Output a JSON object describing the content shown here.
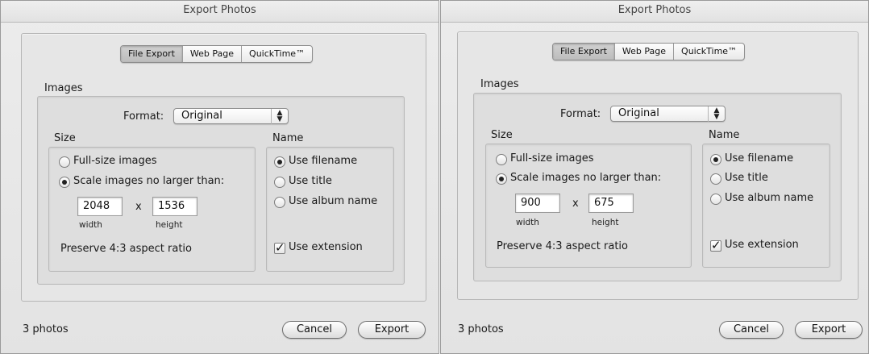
{
  "dialogs": [
    {
      "title": "Export Photos",
      "tabs": [
        "File Export",
        "Web Page",
        "QuickTime™"
      ],
      "selected_tab": "File Export",
      "images_label": "Images",
      "format_label": "Format:",
      "format_value": "Original",
      "size_label": "Size",
      "name_label": "Name",
      "full_size_label": "Full-size images",
      "scale_label": "Scale images no larger than:",
      "width_value": "2048",
      "height_value": "1536",
      "times_label": "x",
      "width_label": "width",
      "height_label": "height",
      "aspect_label": "Preserve 4:3 aspect ratio",
      "use_filename_label": "Use filename",
      "use_title_label": "Use title",
      "use_album_label": "Use album name",
      "use_extension_label": "Use extension",
      "photo_count": "3 photos",
      "cancel_label": "Cancel",
      "export_label": "Export"
    },
    {
      "title": "Export Photos",
      "tabs": [
        "File Export",
        "Web Page",
        "QuickTime™"
      ],
      "selected_tab": "File Export",
      "images_label": "Images",
      "format_label": "Format:",
      "format_value": "Original",
      "size_label": "Size",
      "name_label": "Name",
      "full_size_label": "Full-size images",
      "scale_label": "Scale images no larger than:",
      "width_value": "900",
      "height_value": "675",
      "times_label": "x",
      "width_label": "width",
      "height_label": "height",
      "aspect_label": "Preserve 4:3 aspect ratio",
      "use_filename_label": "Use filename",
      "use_title_label": "Use title",
      "use_album_label": "Use album name",
      "use_extension_label": "Use extension",
      "photo_count": "3 photos",
      "cancel_label": "Cancel",
      "export_label": "Export"
    }
  ]
}
